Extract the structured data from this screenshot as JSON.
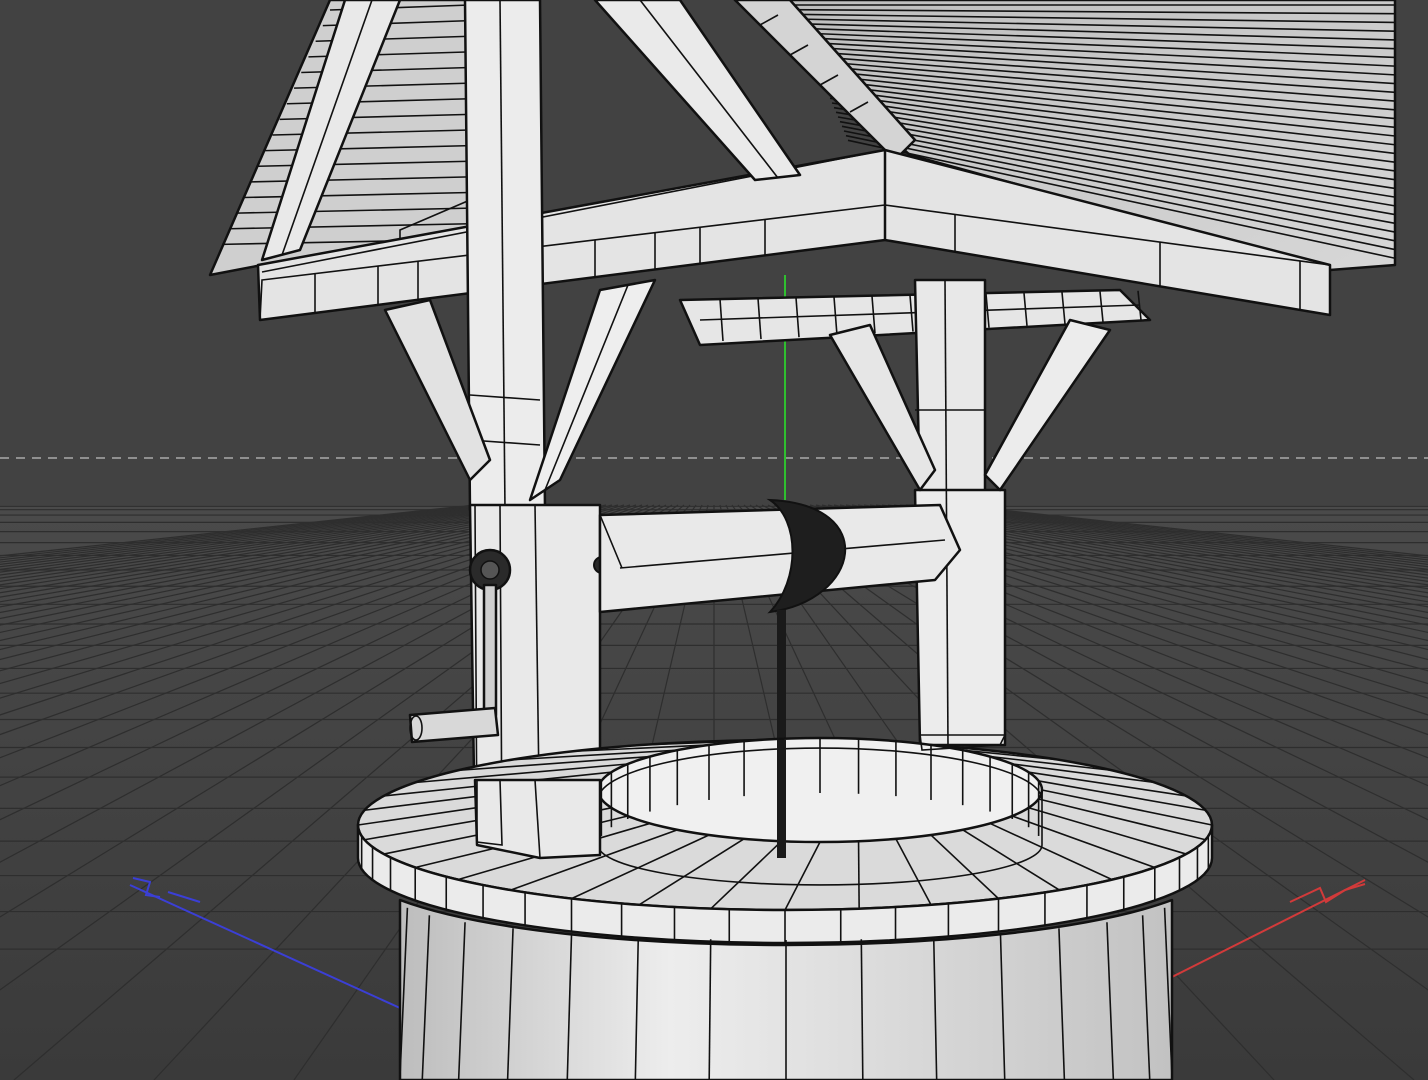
{
  "viewport": {
    "colors": {
      "background": "#3f3f3f",
      "floor_grid": "#2e2e2e",
      "horizon_line": "#a9a9a9",
      "axis_x": "#d23a3a",
      "axis_y": "#2fbf2f",
      "axis_z": "#3b3fd6",
      "model_surface": "#d9d9d9",
      "model_edges": "#111111"
    },
    "axis_icons": {
      "x": "x-axis-arrow-icon",
      "y": "y-axis-line-icon",
      "z": "z-axis-arrow-icon"
    },
    "model": "wishing-well"
  }
}
